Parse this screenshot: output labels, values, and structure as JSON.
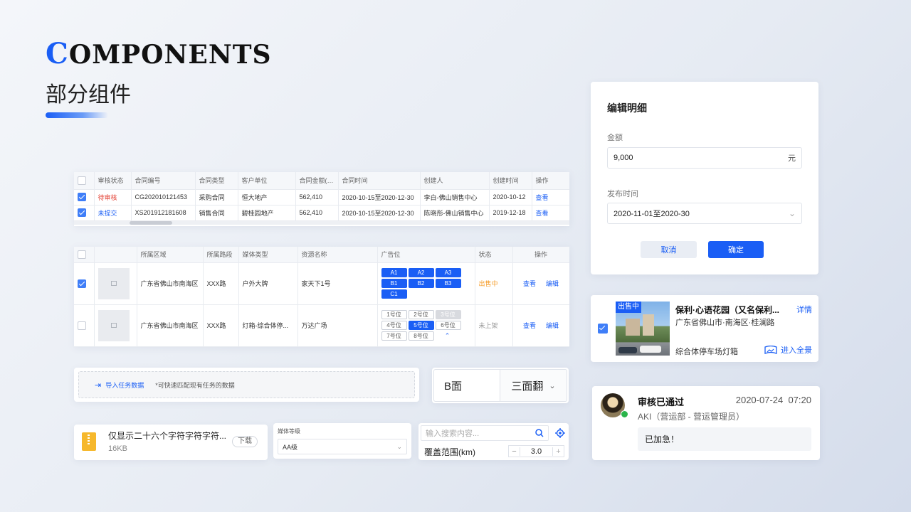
{
  "header": {
    "brand_first": "C",
    "brand_rest": "OMPONENTS",
    "subtitle": "部分组件"
  },
  "table1": {
    "columns": [
      "审核状态",
      "合同编号",
      "合同类型",
      "客户单位",
      "合同金额(元)",
      "合同时间",
      "创建人",
      "创建时间",
      "操作"
    ],
    "rows": [
      {
        "status": "待审核",
        "code": "CG202010121453",
        "type": "采购合同",
        "client": "恒大地产",
        "amount": "562,410",
        "period": "2020-10-15至2020-12-30",
        "creator": "李白-佛山销售中心",
        "created": "2020-10-12",
        "action": "查看"
      },
      {
        "status": "未提交",
        "code": "XS201912181608",
        "type": "销售合同",
        "client": "碧桂园地产",
        "amount": "562,410",
        "period": "2020-10-15至2020-12-30",
        "creator": "陈晓彤-佛山销售中心",
        "created": "2019-12-18",
        "action": "查看"
      }
    ]
  },
  "table2": {
    "columns": [
      "所属区域",
      "所属路段",
      "媒体类型",
      "资源名称",
      "广告位",
      "状态",
      "操作"
    ],
    "rows": [
      {
        "region": "广东省佛山市南海区",
        "road": "XXX路",
        "media": "户外大牌",
        "name": "家天下1号",
        "slots": [
          "A1",
          "A2",
          "A3",
          "B1",
          "B2",
          "B3",
          "C1"
        ],
        "status": "出售中",
        "view": "查看",
        "edit": "编辑"
      },
      {
        "region": "广东省佛山市南海区",
        "road": "XXX路",
        "media": "灯箱-综合体停...",
        "name": "万达广场",
        "slots": [
          "1号位",
          "2号位",
          "3号位",
          "4号位",
          "5号位",
          "6号位",
          "7号位",
          "8号位"
        ],
        "status": "未上架",
        "view": "查看",
        "edit": "编辑"
      }
    ]
  },
  "import_box": {
    "label": "导入任务数据",
    "hint": "*可快速匹配现有任务的数据"
  },
  "face_select": {
    "side": "B面",
    "option": "三面翻"
  },
  "file_item": {
    "name": "仅显示二十六个字符字符字符...",
    "size": "16KB",
    "download": "下载"
  },
  "media_level": {
    "label": "媒体等级",
    "value": "AA级"
  },
  "search_box": {
    "placeholder": "输入搜索内容...",
    "range_label": "覆盖范围(km)",
    "range_value": "3.0",
    "minus": "−",
    "plus": "+"
  },
  "edit_panel": {
    "title": "编辑明细",
    "amount_label": "金额",
    "amount_value": "9,000",
    "amount_unit": "元",
    "date_label": "发布时间",
    "date_value": "2020-11-01至2020-30",
    "cancel": "取消",
    "confirm": "确定"
  },
  "property_card": {
    "badge": "出售中",
    "title": "保利·心语花园（又名保利...",
    "detail_link": "详情",
    "address": "广东省佛山市·南海区·桂澜路",
    "type": "综合体停车场灯箱",
    "panorama": "进入全景"
  },
  "review": {
    "title": "审核已通过",
    "time": "2020-07-24  07:20",
    "user": "AKI（营运部 - 营运管理员）",
    "comment": "已加急！"
  }
}
